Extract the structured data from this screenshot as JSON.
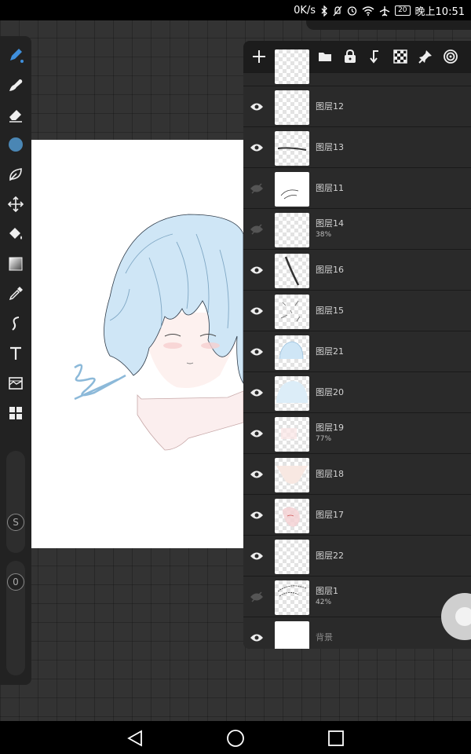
{
  "status_bar": {
    "net_speed": "0K/s",
    "battery": "20",
    "time": "晚上10:51"
  },
  "toolbar": {
    "active_color": "#4a86b4",
    "tools": [
      "brush",
      "smudge",
      "eraser",
      "color",
      "lasso",
      "transform",
      "fill",
      "gradient",
      "eyedropper",
      "curve",
      "text",
      "filter",
      "layers"
    ],
    "size_label": "S",
    "opacity_label": "0"
  },
  "layers_panel": {
    "layers": [
      {
        "name": "图层12",
        "opacity": "",
        "visible": true
      },
      {
        "name": "图层13",
        "opacity": "",
        "visible": true
      },
      {
        "name": "图层11",
        "opacity": "",
        "visible": false
      },
      {
        "name": "图层14",
        "opacity": "38%",
        "visible": false
      },
      {
        "name": "图层16",
        "opacity": "",
        "visible": true
      },
      {
        "name": "图层15",
        "opacity": "",
        "visible": true
      },
      {
        "name": "图层21",
        "opacity": "",
        "visible": true
      },
      {
        "name": "图层20",
        "opacity": "",
        "visible": true
      },
      {
        "name": "图层19",
        "opacity": "77%",
        "visible": true
      },
      {
        "name": "图层18",
        "opacity": "",
        "visible": true
      },
      {
        "name": "图层17",
        "opacity": "",
        "visible": true
      },
      {
        "name": "图层22",
        "opacity": "",
        "visible": true
      },
      {
        "name": "图层1",
        "opacity": "42%",
        "visible": false
      },
      {
        "name": "背景",
        "opacity": "",
        "visible": true
      }
    ]
  },
  "colors": {
    "accent": "#4aa3e6",
    "selected_brush": "#3f8fdc"
  }
}
